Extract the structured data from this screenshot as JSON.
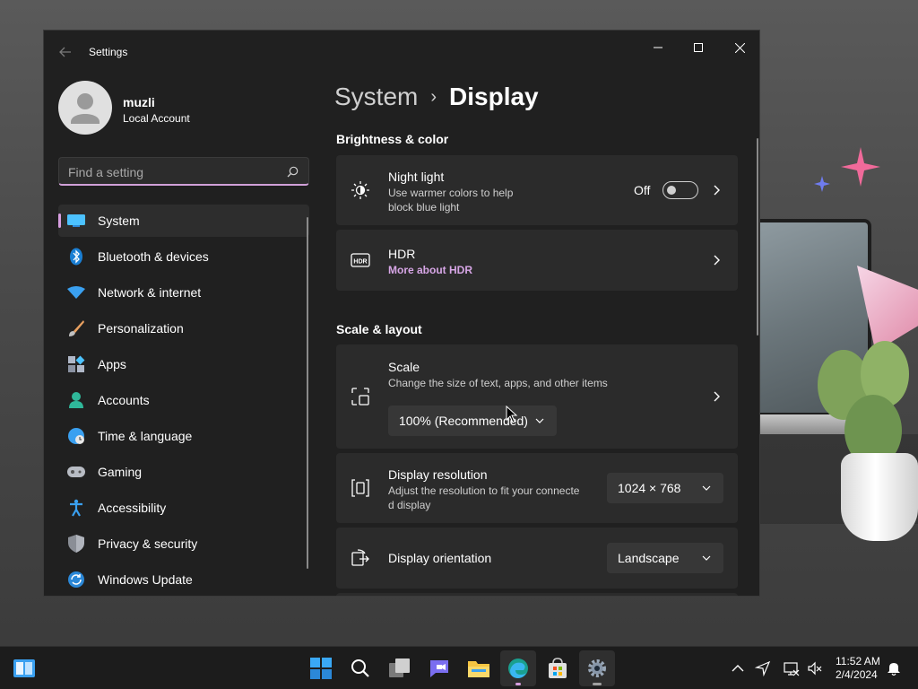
{
  "window": {
    "app_title": "Settings"
  },
  "user": {
    "name": "muzli",
    "account_type": "Local Account"
  },
  "search": {
    "placeholder": "Find a setting"
  },
  "sidebar": {
    "items": [
      {
        "label": "System",
        "icon": "system-icon",
        "active": true
      },
      {
        "label": "Bluetooth & devices",
        "icon": "bluetooth-icon"
      },
      {
        "label": "Network & internet",
        "icon": "wifi-icon"
      },
      {
        "label": "Personalization",
        "icon": "brush-icon"
      },
      {
        "label": "Apps",
        "icon": "apps-icon"
      },
      {
        "label": "Accounts",
        "icon": "accounts-icon"
      },
      {
        "label": "Time & language",
        "icon": "globe-clock-icon"
      },
      {
        "label": "Gaming",
        "icon": "gamepad-icon"
      },
      {
        "label": "Accessibility",
        "icon": "accessibility-icon"
      },
      {
        "label": "Privacy & security",
        "icon": "shield-icon"
      },
      {
        "label": "Windows Update",
        "icon": "update-icon"
      }
    ]
  },
  "breadcrumb": {
    "parent": "System",
    "current": "Display"
  },
  "brightness_section": {
    "title": "Brightness & color",
    "night_light": {
      "title": "Night light",
      "desc_line1": "Use warmer colors to help",
      "desc_line2": "block blue light",
      "toggle_label": "Off"
    },
    "hdr": {
      "title": "HDR",
      "link": "More about HDR"
    }
  },
  "scale_section": {
    "title": "Scale & layout",
    "scale": {
      "title": "Scale",
      "desc": "Change the size of text, apps, and other items",
      "value": "100% (Recommended)"
    },
    "resolution": {
      "title": "Display resolution",
      "desc_line1": "Adjust the resolution to fit your connecte",
      "desc_line2": "d display",
      "value": "1024 × 768"
    },
    "orientation": {
      "title": "Display orientation",
      "value": "Landscape"
    }
  },
  "taskbar": {
    "time": "11:52 AM",
    "date": "2/4/2024"
  },
  "colors": {
    "accent": "#d79ee0",
    "window_bg": "#202020",
    "card_bg": "#2b2b2b"
  }
}
